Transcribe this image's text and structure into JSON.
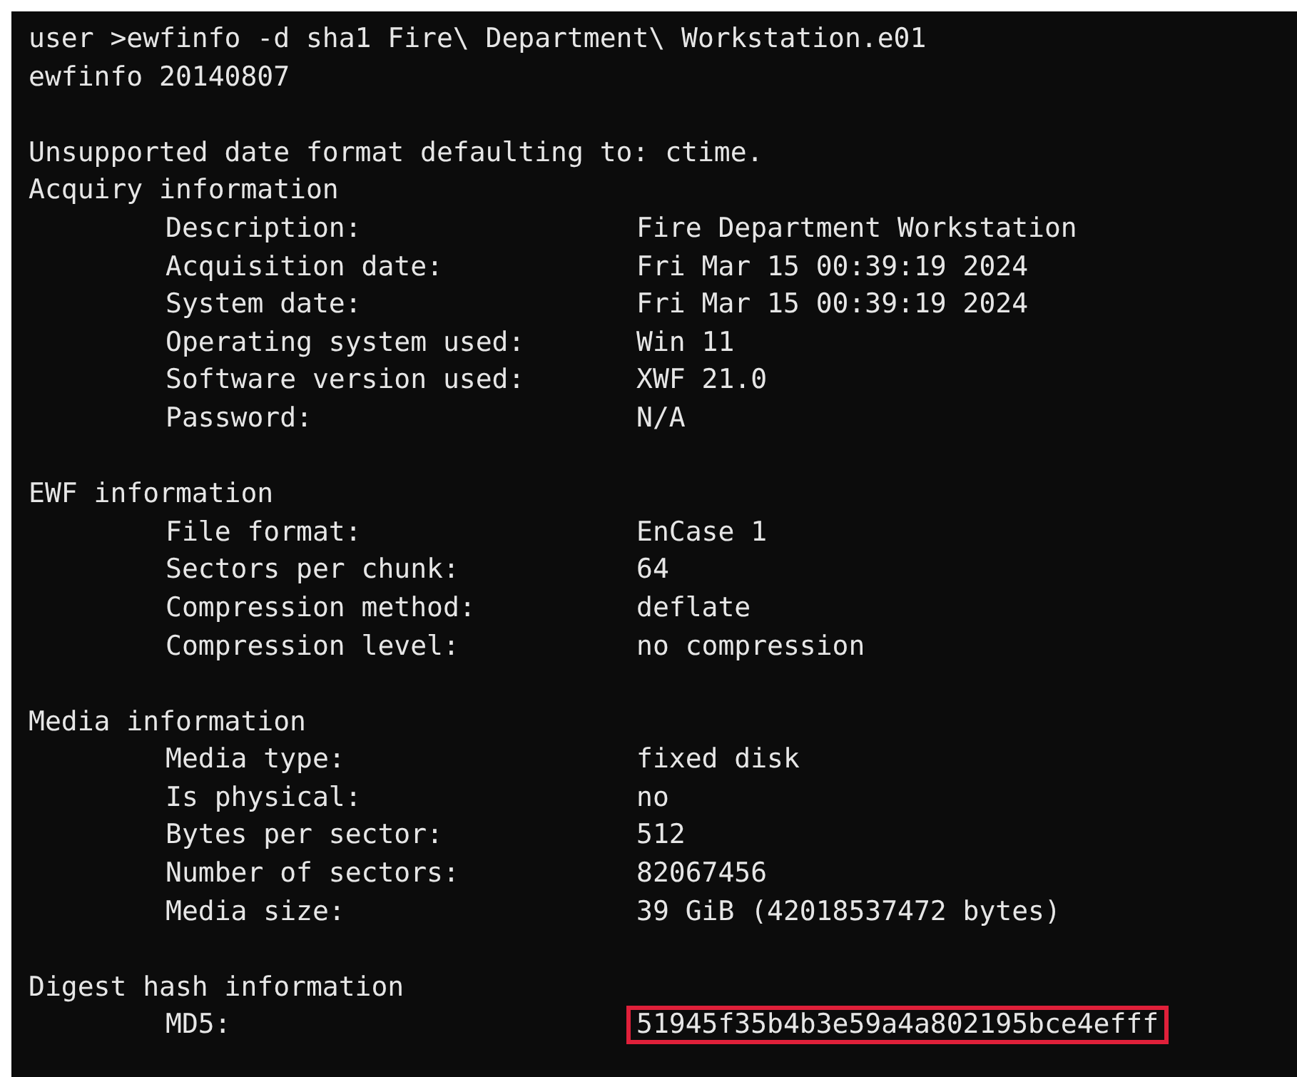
{
  "terminal": {
    "header_lines": [
      "user >ewfinfo -d sha1 Fire\\ Department\\ Workstation.e01",
      "ewfinfo 20140807"
    ],
    "notice_lines": [
      "Unsupported date format defaulting to: ctime."
    ],
    "sections": [
      {
        "title": "Acquiry information",
        "rows": [
          {
            "label": "Description:",
            "value": "Fire Department Workstation",
            "highlighted": false
          },
          {
            "label": "Acquisition date:",
            "value": "Fri Mar 15 00:39:19 2024",
            "highlighted": false
          },
          {
            "label": "System date:",
            "value": "Fri Mar 15 00:39:19 2024",
            "highlighted": false
          },
          {
            "label": "Operating system used:",
            "value": "Win 11",
            "highlighted": false
          },
          {
            "label": "Software version used:",
            "value": "XWF 21.0",
            "highlighted": false
          },
          {
            "label": "Password:",
            "value": "N/A",
            "highlighted": false
          }
        ]
      },
      {
        "title": "EWF information",
        "rows": [
          {
            "label": "File format:",
            "value": "EnCase 1",
            "highlighted": false
          },
          {
            "label": "Sectors per chunk:",
            "value": "64",
            "highlighted": false
          },
          {
            "label": "Compression method:",
            "value": "deflate",
            "highlighted": false
          },
          {
            "label": "Compression level:",
            "value": "no compression",
            "highlighted": false
          }
        ]
      },
      {
        "title": "Media information",
        "rows": [
          {
            "label": "Media type:",
            "value": "fixed disk",
            "highlighted": false
          },
          {
            "label": "Is physical:",
            "value": "no",
            "highlighted": false
          },
          {
            "label": "Bytes per sector:",
            "value": "512",
            "highlighted": false
          },
          {
            "label": "Number of sectors:",
            "value": "82067456",
            "highlighted": false
          },
          {
            "label": "Media size:",
            "value": "39 GiB (42018537472 bytes)",
            "highlighted": false
          }
        ]
      },
      {
        "title": "Digest hash information",
        "rows": [
          {
            "label": "MD5:",
            "value": "51945f35b4b3e59a4a802195bce4efff",
            "highlighted": true
          }
        ]
      }
    ]
  }
}
